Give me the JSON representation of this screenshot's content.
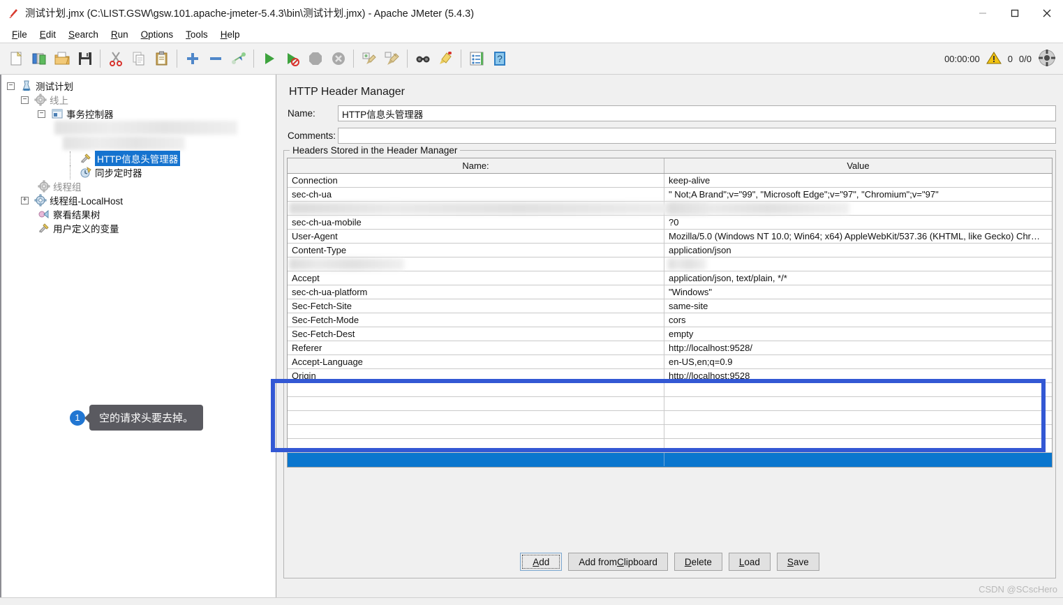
{
  "window": {
    "title": "测试计划.jmx (C:\\LIST.GSW\\gsw.101.apache-jmeter-5.4.3\\bin\\测试计划.jmx) - Apache JMeter (5.4.3)",
    "app_icon": "jmeter-feather-icon",
    "minimize_label": "—",
    "maximize_label": "▢",
    "close_label": "✕"
  },
  "menubar": {
    "items": [
      {
        "label": "File",
        "mnemonic": "F"
      },
      {
        "label": "Edit",
        "mnemonic": "E"
      },
      {
        "label": "Search",
        "mnemonic": "S"
      },
      {
        "label": "Run",
        "mnemonic": "R"
      },
      {
        "label": "Options",
        "mnemonic": "O"
      },
      {
        "label": "Tools",
        "mnemonic": "T"
      },
      {
        "label": "Help",
        "mnemonic": "H"
      }
    ]
  },
  "toolbar": {
    "buttons": [
      {
        "name": "new-icon"
      },
      {
        "name": "templates-icon"
      },
      {
        "name": "open-icon"
      },
      {
        "name": "save-icon"
      },
      {
        "sep": true
      },
      {
        "name": "cut-icon"
      },
      {
        "name": "copy-icon"
      },
      {
        "name": "paste-icon"
      },
      {
        "sep": true
      },
      {
        "name": "expand-all-icon"
      },
      {
        "name": "collapse-all-icon"
      },
      {
        "name": "toggle-icon"
      },
      {
        "sep": true
      },
      {
        "name": "start-icon"
      },
      {
        "name": "start-no-pauses-icon"
      },
      {
        "name": "stop-icon"
      },
      {
        "name": "shutdown-icon"
      },
      {
        "sep": true
      },
      {
        "name": "clear-icon"
      },
      {
        "name": "clear-all-icon"
      },
      {
        "sep": true
      },
      {
        "name": "search-icon"
      },
      {
        "name": "reset-search-icon"
      },
      {
        "sep": true
      },
      {
        "name": "function-helper-icon"
      },
      {
        "name": "help-icon"
      }
    ],
    "status": {
      "elapsed": "00:00:00",
      "warning_icon": "warning-triangle-icon",
      "warning_count": "0",
      "threads": "0/0",
      "connection_icon": "remote-status-icon"
    }
  },
  "tree": {
    "nodes": [
      {
        "label": "测试计划",
        "icon": "test-plan-icon",
        "depth": 0,
        "toggle": "minus",
        "state": "normal"
      },
      {
        "label": "线上",
        "icon": "thread-group-icon",
        "depth": 1,
        "toggle": "minus",
        "state": "disabled"
      },
      {
        "label": "事务控制器",
        "icon": "transaction-controller-icon",
        "depth": 2,
        "toggle": "minus",
        "state": "normal"
      },
      {
        "label": "",
        "icon": "redacted",
        "depth": 3,
        "toggle": "none",
        "state": "redacted"
      },
      {
        "label": "",
        "icon": "redacted",
        "depth": 3,
        "toggle": "none",
        "state": "redacted"
      },
      {
        "label": "HTTP信息头管理器",
        "icon": "header-manager-icon",
        "depth": 4,
        "toggle": "none",
        "state": "selected"
      },
      {
        "label": "同步定时器",
        "icon": "sync-timer-icon",
        "depth": 4,
        "toggle": "none",
        "state": "normal"
      },
      {
        "label": "线程组",
        "icon": "thread-group-icon",
        "depth": 1,
        "toggle": "none",
        "state": "disabled"
      },
      {
        "label": "线程组-LocalHost",
        "icon": "thread-group-icon",
        "depth": 1,
        "toggle": "plus",
        "state": "normal"
      },
      {
        "label": "察看结果树",
        "icon": "view-results-tree-icon",
        "depth": 1,
        "toggle": "none",
        "state": "normal"
      },
      {
        "label": "用户定义的变量",
        "icon": "user-defined-variables-icon",
        "depth": 1,
        "toggle": "none",
        "state": "normal"
      }
    ]
  },
  "panel": {
    "title": "HTTP Header Manager",
    "name_label": "Name:",
    "name_value": "HTTP信息头管理器",
    "comments_label": "Comments:",
    "comments_value": "",
    "comments_placeholder": "",
    "group_title": "Headers Stored in the Header Manager"
  },
  "table": {
    "columns": [
      "Name:",
      "Value"
    ],
    "rows": [
      {
        "name": "Connection",
        "value": "keep-alive",
        "redacted": false,
        "selected": false
      },
      {
        "name": "sec-ch-ua",
        "value": "\" Not;A Brand\";v=\"99\", \"Microsoft Edge\";v=\"97\", \"Chromium\";v=\"97\"",
        "redacted": false,
        "selected": false
      },
      {
        "name": "",
        "value": "",
        "redacted": true,
        "selected": false
      },
      {
        "name": "sec-ch-ua-mobile",
        "value": "?0",
        "redacted": false,
        "selected": false
      },
      {
        "name": "User-Agent",
        "value": "Mozilla/5.0 (Windows NT 10.0; Win64; x64) AppleWebKit/537.36 (KHTML, like Gecko) Chr…",
        "redacted": false,
        "selected": false
      },
      {
        "name": "Content-Type",
        "value": "application/json",
        "redacted": false,
        "selected": false
      },
      {
        "name": "",
        "value": "",
        "redacted": true,
        "selected": false
      },
      {
        "name": "Accept",
        "value": "application/json, text/plain, */*",
        "redacted": false,
        "selected": false
      },
      {
        "name": "sec-ch-ua-platform",
        "value": "\"Windows\"",
        "redacted": false,
        "selected": false
      },
      {
        "name": "Sec-Fetch-Site",
        "value": "same-site",
        "redacted": false,
        "selected": false
      },
      {
        "name": "Sec-Fetch-Mode",
        "value": "cors",
        "redacted": false,
        "selected": false
      },
      {
        "name": "Sec-Fetch-Dest",
        "value": "empty",
        "redacted": false,
        "selected": false
      },
      {
        "name": "Referer",
        "value": "http://localhost:9528/",
        "redacted": false,
        "selected": false
      },
      {
        "name": "Accept-Language",
        "value": "en-US,en;q=0.9",
        "redacted": false,
        "selected": false
      },
      {
        "name": "Origin",
        "value": "http://localhost:9528",
        "redacted": false,
        "selected": false
      },
      {
        "name": "",
        "value": "",
        "redacted": false,
        "selected": false
      },
      {
        "name": "",
        "value": "",
        "redacted": false,
        "selected": false
      },
      {
        "name": "",
        "value": "",
        "redacted": false,
        "selected": false
      },
      {
        "name": "",
        "value": "",
        "redacted": false,
        "selected": false
      },
      {
        "name": "",
        "value": "",
        "redacted": false,
        "selected": false
      },
      {
        "name": "",
        "value": "",
        "redacted": false,
        "selected": true
      }
    ]
  },
  "buttons": {
    "add": {
      "label": "Add",
      "mnemonic": "A",
      "focused": true
    },
    "add_clipboard": {
      "label": "Add from Clipboard",
      "mnemonic": "C",
      "focused": false
    },
    "delete": {
      "label": "Delete",
      "mnemonic": "D",
      "focused": false
    },
    "load": {
      "label": "Load",
      "mnemonic": "L",
      "focused": false
    },
    "save": {
      "label": "Save",
      "mnemonic": "S",
      "focused": false
    }
  },
  "annotation": {
    "number": "1",
    "text": "空的请求头要去掉。",
    "highlight_color": "#3358d4",
    "bubble_color": "#5a5a60",
    "badge_color": "#2176d2"
  },
  "watermark": {
    "text": "CSDN @SCscHero"
  },
  "colors": {
    "selection_blue": "#0a76ce",
    "tree_selection": "#1573cf",
    "panel_bg": "#f0f0f0",
    "accent": "#3358d4"
  }
}
